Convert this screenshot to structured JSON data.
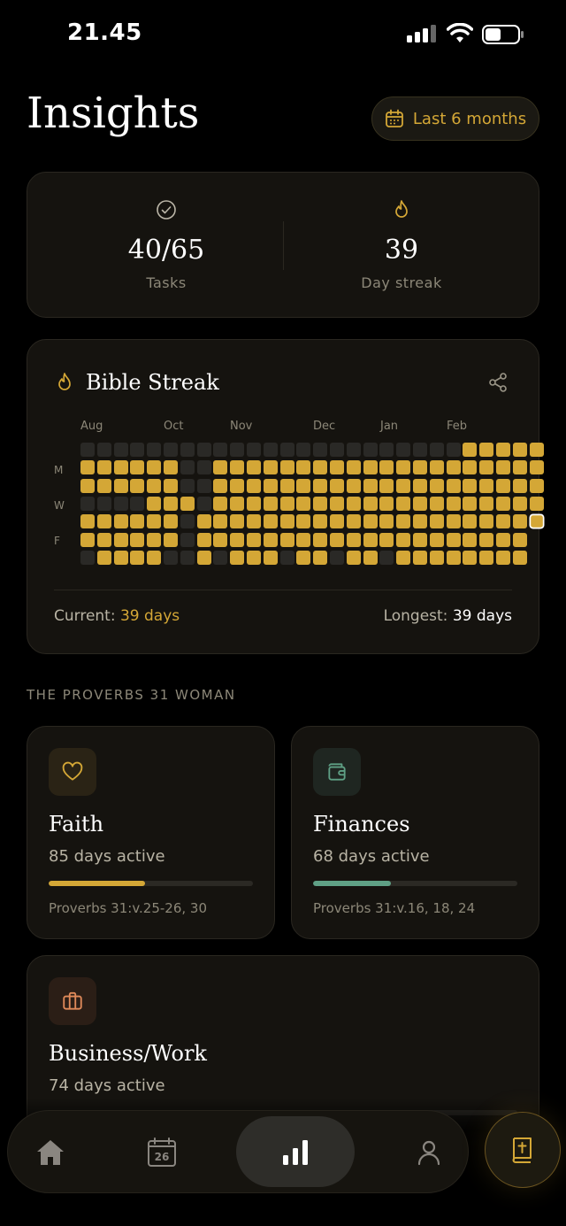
{
  "status_bar": {
    "time": "21.45"
  },
  "header": {
    "title": "Insights",
    "range_label": "Last 6 months"
  },
  "stats": {
    "tasks": {
      "value": "40/65",
      "label": "Tasks"
    },
    "streak": {
      "value": "39",
      "label": "Day streak"
    }
  },
  "bible_streak": {
    "title": "Bible Streak",
    "months": [
      "Aug",
      "Oct",
      "Nov",
      "Dec",
      "Jan",
      "Feb"
    ],
    "day_labels": [
      "M",
      "W",
      "F"
    ],
    "current_label": "Current:",
    "current_value": "39 days",
    "longest_label": "Longest:",
    "longest_value": "39 days",
    "grid_rows": [
      "0000000000000000000000011111",
      "1111110011111111111111111111",
      "1111110011111111111111111111",
      "0000111011111111111111111111",
      "111111011111111111111111111T",
      "111111011111111111111111111",
      "011110010111011011011111111"
    ]
  },
  "section_title": "THE PROVERBS 31 WOMAN",
  "categories": [
    {
      "name": "Faith",
      "days": "85 days active",
      "ref": "Proverbs 31:v.25-26, 30",
      "progress": 0.47,
      "color": "#d4a736",
      "icon": "heart-icon"
    },
    {
      "name": "Finances",
      "days": "68 days active",
      "ref": "Proverbs 31:v.16, 18, 24",
      "progress": 0.38,
      "color": "#5fa085",
      "icon": "wallet-icon"
    },
    {
      "name": "Business/Work",
      "days": "74 days active",
      "ref": "",
      "progress": 0.41,
      "color": "#e08a5a",
      "icon": "briefcase-icon"
    }
  ],
  "nav": {
    "calendar_day": "26",
    "items": [
      "home-icon",
      "calendar-icon",
      "insights-icon",
      "profile-icon"
    ],
    "fab_icon": "bible-icon"
  },
  "colors": {
    "accent": "#d4a736",
    "card": "#15130f",
    "inactive_cell": "#2a2926"
  }
}
